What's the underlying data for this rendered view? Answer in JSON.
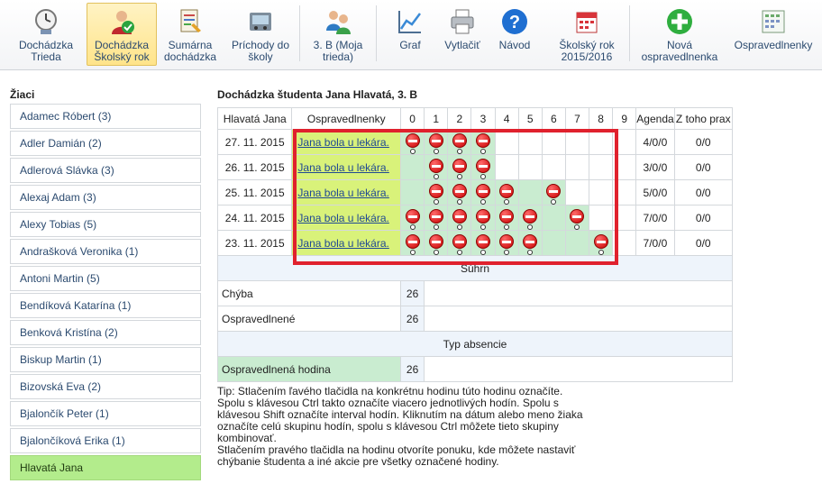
{
  "toolbar": {
    "items": [
      {
        "label": "Dochádzka\nTrieda",
        "icon": "clock-user-icon"
      },
      {
        "label": "Dochádzka\nŠkolský rok",
        "icon": "user-check-icon"
      },
      {
        "label": "Sumárna\ndochádzka",
        "icon": "report-icon"
      },
      {
        "label": "Príchody do\nškoly",
        "icon": "door-entry-icon"
      },
      {
        "label": "3. B (Moja\ntrieda)",
        "icon": "group-icon"
      },
      {
        "label": "Graf",
        "icon": "chart-icon"
      },
      {
        "label": "Vytlačiť",
        "icon": "printer-icon"
      },
      {
        "label": "Návod",
        "icon": "help-icon"
      },
      {
        "label": "Školský rok\n2015/2016",
        "icon": "calendar-icon"
      },
      {
        "label": "Nová\nospravedlnenka",
        "icon": "add-icon"
      },
      {
        "label": "Ospravedlnenky",
        "icon": "excuse-list-icon"
      }
    ]
  },
  "sidebar": {
    "title": "Žiaci",
    "students": [
      {
        "name": "Adamec Róbert (3)"
      },
      {
        "name": "Adler Damián (2)"
      },
      {
        "name": "Adlerová Slávka (3)"
      },
      {
        "name": "Alexaj Adam (3)"
      },
      {
        "name": "Alexy Tobias (5)"
      },
      {
        "name": "Andrašková Veronika (1)"
      },
      {
        "name": "Antoni Martin (5)"
      },
      {
        "name": "Bendíková Katarína (1)"
      },
      {
        "name": "Benková Kristína (2)"
      },
      {
        "name": "Biskup Martin (1)"
      },
      {
        "name": "Bizovská Eva (2)"
      },
      {
        "name": "Bjalončík Peter (1)"
      },
      {
        "name": "Bjalončíková Erika (1)"
      },
      {
        "name": "Hlavatá Jana"
      }
    ]
  },
  "main": {
    "title": "Dochádzka študenta Jana Hlavatá, 3. B",
    "table": {
      "headers": {
        "name": "Hlavatá Jana",
        "note": "Ospravedlnenky",
        "hours": [
          "0",
          "1",
          "2",
          "3",
          "4",
          "5",
          "6",
          "7",
          "8",
          "9"
        ],
        "agenda": "Agenda",
        "prax": "Z toho prax"
      },
      "rows": [
        {
          "date": "27. 11. 2015",
          "note": "Jana bola u lekára.",
          "absent": [
            0,
            1,
            2,
            3
          ],
          "agenda": "4/0/0",
          "prax": "0/0"
        },
        {
          "date": "26. 11. 2015",
          "note": "Jana bola u lekára.",
          "absent": [
            1,
            2,
            3
          ],
          "agenda": "3/0/0",
          "prax": "0/0"
        },
        {
          "date": "25. 11. 2015",
          "note": "Jana bola u lekára.",
          "absent": [
            1,
            2,
            3,
            4,
            6
          ],
          "agenda": "5/0/0",
          "prax": "0/0"
        },
        {
          "date": "24. 11. 2015",
          "note": "Jana bola u lekára.",
          "absent": [
            0,
            1,
            2,
            3,
            4,
            5,
            7
          ],
          "agenda": "7/0/0",
          "prax": "0/0"
        },
        {
          "date": "23. 11. 2015",
          "note": "Jana bola u lekára.",
          "absent": [
            0,
            1,
            2,
            3,
            4,
            5,
            8
          ],
          "agenda": "7/0/0",
          "prax": "0/0"
        }
      ],
      "summary_label": "Súhrn",
      "summary": [
        {
          "label": "Chýba",
          "value": "26"
        },
        {
          "label": "Ospravedlnené",
          "value": "26"
        }
      ],
      "absence_type_label": "Typ absencie",
      "absence_types": [
        {
          "label": "Ospravedlnená hodina",
          "value": "26"
        }
      ]
    }
  },
  "tip": {
    "paragraph1": "Tip: Stlačením ľavého tlačidla na konkrétnu hodinu túto hodinu označíte. Spolu s klávesou Ctrl takto označíte viacero jednotlivých hodín. Spolu s klávesou Shift označíte interval hodín. Kliknutím na dátum alebo meno žiaka označíte celú skupinu hodín, spolu s klávesou Ctrl môžete tieto skupiny kombinovať.",
    "paragraph2": "Stlačením pravého tlačidla na hodinu otvoríte ponuku, kde môžete nastaviť chýbanie študenta a iné akcie pre všetky označené hodiny."
  },
  "colors": {
    "selected_student": "#b3ec8c",
    "note_cell": "#d9f27a",
    "marked_hour": "#c9ecd0",
    "highlight_frame": "#e0212d",
    "active_toolbar": "#ffe48a"
  }
}
